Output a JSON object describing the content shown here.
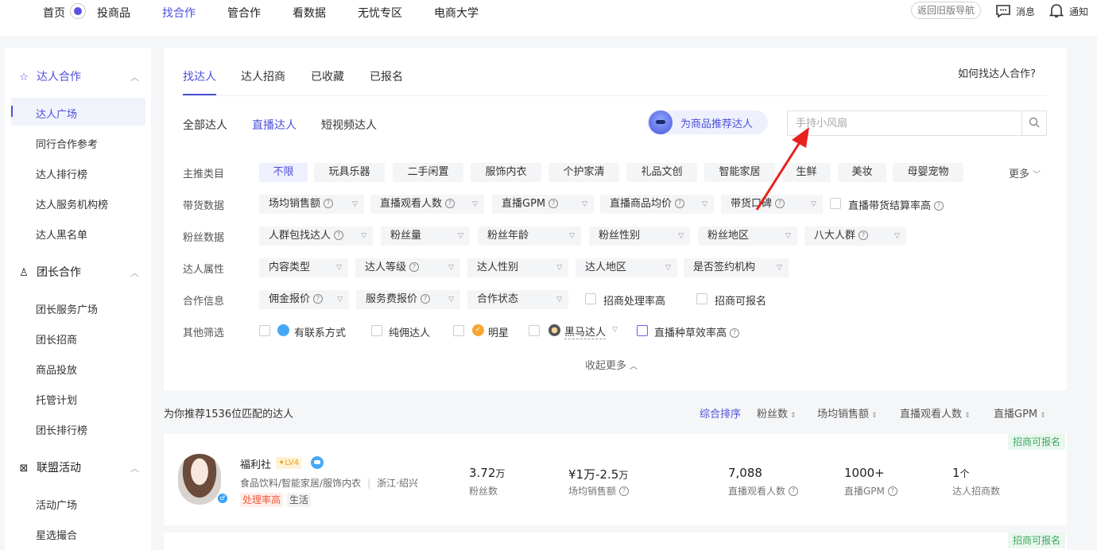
{
  "topnav": {
    "items": [
      "首页",
      "投商品",
      "找合作",
      "管合作",
      "看数据",
      "无忧专区",
      "电商大学"
    ],
    "active": "找合作",
    "old_nav": "返回旧版导航",
    "messages": "消息",
    "notifications": "通知"
  },
  "sidebar": {
    "groups": [
      {
        "label": "达人合作",
        "items": [
          "达人广场",
          "同行合作参考",
          "达人排行榜",
          "达人服务机构榜",
          "达人黑名单"
        ]
      },
      {
        "label": "团长合作",
        "items": [
          "团长服务广场",
          "团长招商",
          "商品投放",
          "托管计划",
          "团长排行榜"
        ]
      },
      {
        "label": "联盟活动",
        "items": [
          "活动广场",
          "星选撮合"
        ]
      }
    ],
    "active_item": "达人广场"
  },
  "tabs": [
    "找达人",
    "达人招商",
    "已收藏",
    "已报名"
  ],
  "active_tab": "找达人",
  "howto": "如何找达人合作?",
  "subtabs": [
    "全部达人",
    "直播达人",
    "短视频达人"
  ],
  "active_subtab": "直播达人",
  "recommend_label": "为商品推荐达人",
  "search": {
    "placeholder": "手持小风扇"
  },
  "filters": {
    "category": {
      "label": "主推类目",
      "options": [
        "不限",
        "玩具乐器",
        "二手闲置",
        "服饰内衣",
        "个护家清",
        "礼品文创",
        "智能家居",
        "生鲜",
        "美妆",
        "母婴宠物"
      ],
      "more": "更多"
    },
    "sales": {
      "label": "带货数据",
      "dropdowns": [
        "场均销售额",
        "直播观看人数",
        "直播GPM",
        "直播商品均价",
        "带货口碑"
      ],
      "checkbox": "直播带货结算率高"
    },
    "fans": {
      "label": "粉丝数据",
      "dropdowns": [
        "人群包找达人",
        "粉丝量",
        "粉丝年龄",
        "粉丝性别",
        "粉丝地区",
        "八大人群"
      ]
    },
    "attrs": {
      "label": "达人属性",
      "dropdowns": [
        "内容类型",
        "达人等级",
        "达人性别",
        "达人地区",
        "是否签约机构"
      ]
    },
    "coop": {
      "label": "合作信息",
      "dropdowns": [
        "佣金报价",
        "服务费报价",
        "合作状态"
      ],
      "checkboxes": [
        "招商处理率高",
        "招商可报名"
      ]
    },
    "other": {
      "label": "其他筛选",
      "checkboxes": [
        "有联系方式",
        "纯佣达人",
        "明星",
        "黑马达人",
        "直播种草效率高"
      ]
    },
    "collapse": "收起更多"
  },
  "results": {
    "count_text": "为你推荐1536位匹配的达人",
    "sorts": [
      "综合排序",
      "粉丝数",
      "场均销售额",
      "直播观看人数",
      "直播GPM"
    ],
    "active_sort": "综合排序"
  },
  "cards": [
    {
      "badge": "招商可报名",
      "name": "福利社",
      "level": "LV4",
      "categories": "食品饮料/智能家居/服饰内衣",
      "location": "浙江·绍兴",
      "tags": [
        "处理率高",
        "生活"
      ],
      "stats": [
        {
          "value": "3.72",
          "unit": "万",
          "label": "粉丝数"
        },
        {
          "value": "¥1万-2.5",
          "unit": "万",
          "label": "场均销售额"
        },
        {
          "value": "7,088",
          "unit": "",
          "label": "直播观看人数"
        },
        {
          "value": "1000+",
          "unit": "",
          "label": "直播GPM"
        },
        {
          "value": "1",
          "unit": "个",
          "label": "达人招商数"
        }
      ]
    },
    {
      "badge": "招商可报名"
    }
  ],
  "colors": {
    "accent": "#4b4fdb",
    "badge_green": "#39a860",
    "annotation_red": "#e8211d"
  }
}
